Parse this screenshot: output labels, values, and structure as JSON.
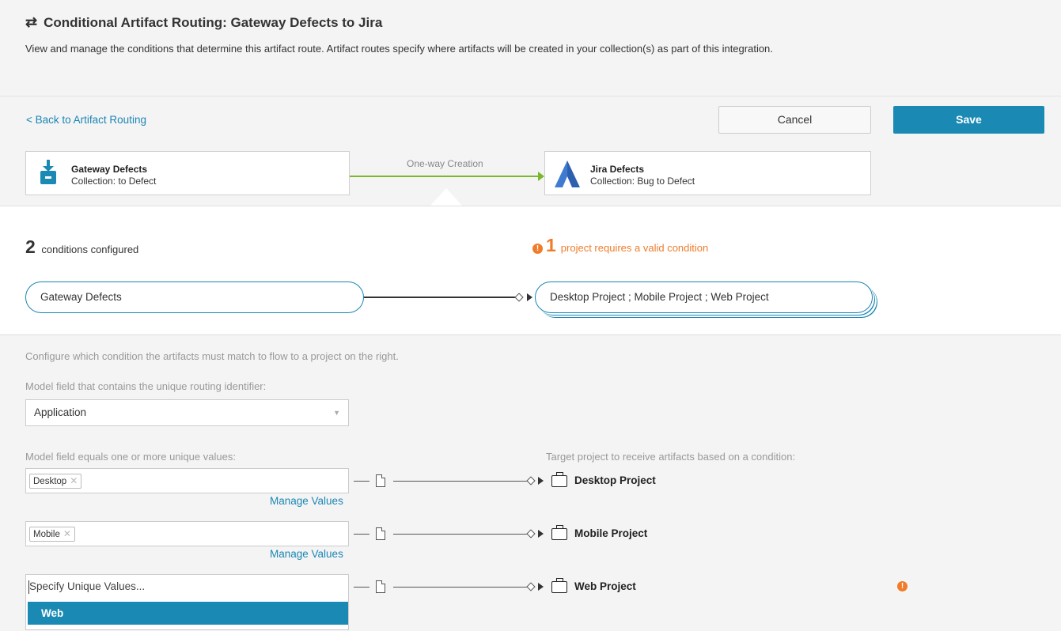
{
  "header": {
    "icon": "swap-arrows-icon",
    "title": "Conditional Artifact Routing: Gateway Defects to Jira",
    "description": "View and manage the conditions that determine this artifact route. Artifact routes specify where artifacts will be created in your collection(s) as part of this integration."
  },
  "toolbar": {
    "back_label": "< Back to Artifact Routing",
    "cancel_label": "Cancel",
    "save_label": "Save"
  },
  "flow": {
    "label": "One-way Creation",
    "source": {
      "name": "Gateway Defects",
      "collection": "Collection: to Defect",
      "icon": "download-box-icon"
    },
    "target": {
      "name": "Jira Defects",
      "collection": "Collection: Bug to Defect",
      "icon": "jira-logo-icon"
    }
  },
  "summary": {
    "count": "2",
    "count_label": "conditions configured",
    "warning_count": "1",
    "warning_label": "project requires a valid condition"
  },
  "route": {
    "source_pill": "Gateway Defects",
    "target_pill": "Desktop Project ; Mobile Project ; Web Project"
  },
  "config": {
    "intro": "Configure which condition the artifacts must match to flow to a project on the right.",
    "field_label": "Model field that contains the unique routing identifier:",
    "field_value": "Application",
    "values_label": "Model field equals one or more unique values:",
    "target_label": "Target project to receive artifacts based on a condition:",
    "manage_values": "Manage Values",
    "placeholder": "Specify Unique Values...",
    "rows": [
      {
        "value": "Desktop",
        "project": "Desktop Project"
      },
      {
        "value": "Mobile",
        "project": "Mobile Project"
      },
      {
        "value": "",
        "project": "Web Project"
      }
    ],
    "dropdown_option": "Web"
  },
  "colors": {
    "accent": "#1a8ab5",
    "warning": "#f07c2a",
    "flow_line": "#7cb82f"
  }
}
